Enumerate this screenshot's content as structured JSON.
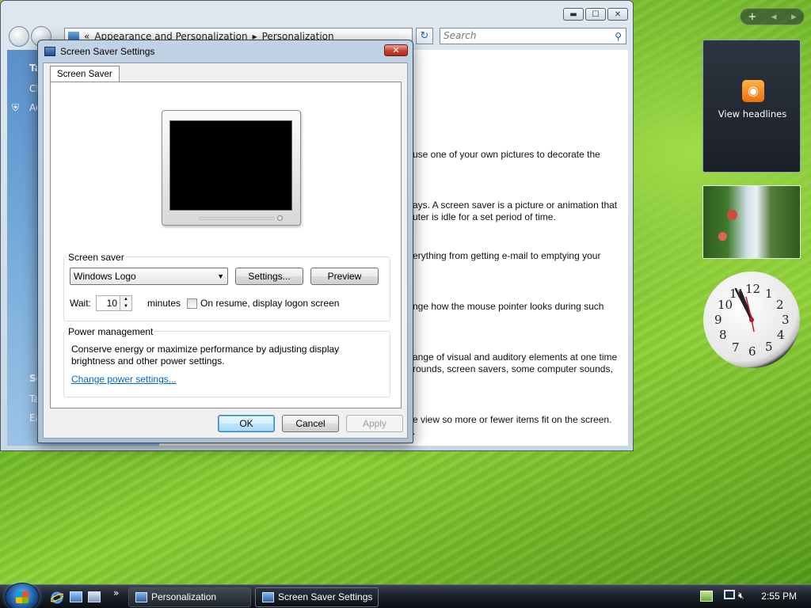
{
  "explorer": {
    "address_prefix": "«",
    "address_part1": "Appearance and Personalization",
    "address_sep": "▸",
    "address_part2": "Personalization",
    "search_placeholder": "Search",
    "left_items": [
      "Ta",
      "Cl",
      "Ad",
      "Se",
      "Ta",
      "Ea"
    ],
    "content_lines": [
      "use one of your own pictures to decorate the",
      "ays. A screen saver is a picture or animation that",
      "uter is idle for a set period of time.",
      "erything from getting e-mail to emptying your",
      "nge how the mouse pointer looks during such",
      "ange of visual and auditory elements at one time",
      "rounds, screen savers, some computer sounds,",
      "e view so more or fewer items fit on the screen.",
      "."
    ]
  },
  "dialog": {
    "title": "Screen Saver Settings",
    "close_glyph": "✕",
    "tab_label": "Screen Saver",
    "screen_saver_group_label": "Screen saver",
    "selected_screensaver": "Windows Logo",
    "settings_button": "Settings...",
    "preview_button": "Preview",
    "wait_label": "Wait:",
    "wait_value": "10",
    "minutes_label": "minutes",
    "resume_checkbox_label": "On resume, display logon screen",
    "resume_checked": false,
    "power_group_label": "Power management",
    "power_text_line1": "Conserve energy or maximize performance by adjusting display",
    "power_text_line2": "brightness and other power settings.",
    "power_link": "Change power settings...",
    "ok_button": "OK",
    "cancel_button": "Cancel",
    "apply_button": "Apply"
  },
  "sidebar": {
    "add_glyph": "+",
    "prev_glyph": "◂",
    "next_glyph": "▸",
    "feed_label": "View headlines"
  },
  "clock_numbers": [
    "12",
    "1",
    "2",
    "3",
    "4",
    "5",
    "6",
    "7",
    "8",
    "9",
    "10",
    "11"
  ],
  "taskbar": {
    "tasks": [
      {
        "label": "Personalization",
        "active": false
      },
      {
        "label": "Screen Saver Settings",
        "active": true
      }
    ],
    "time": "2:55 PM",
    "overflow_glyph": "»"
  }
}
